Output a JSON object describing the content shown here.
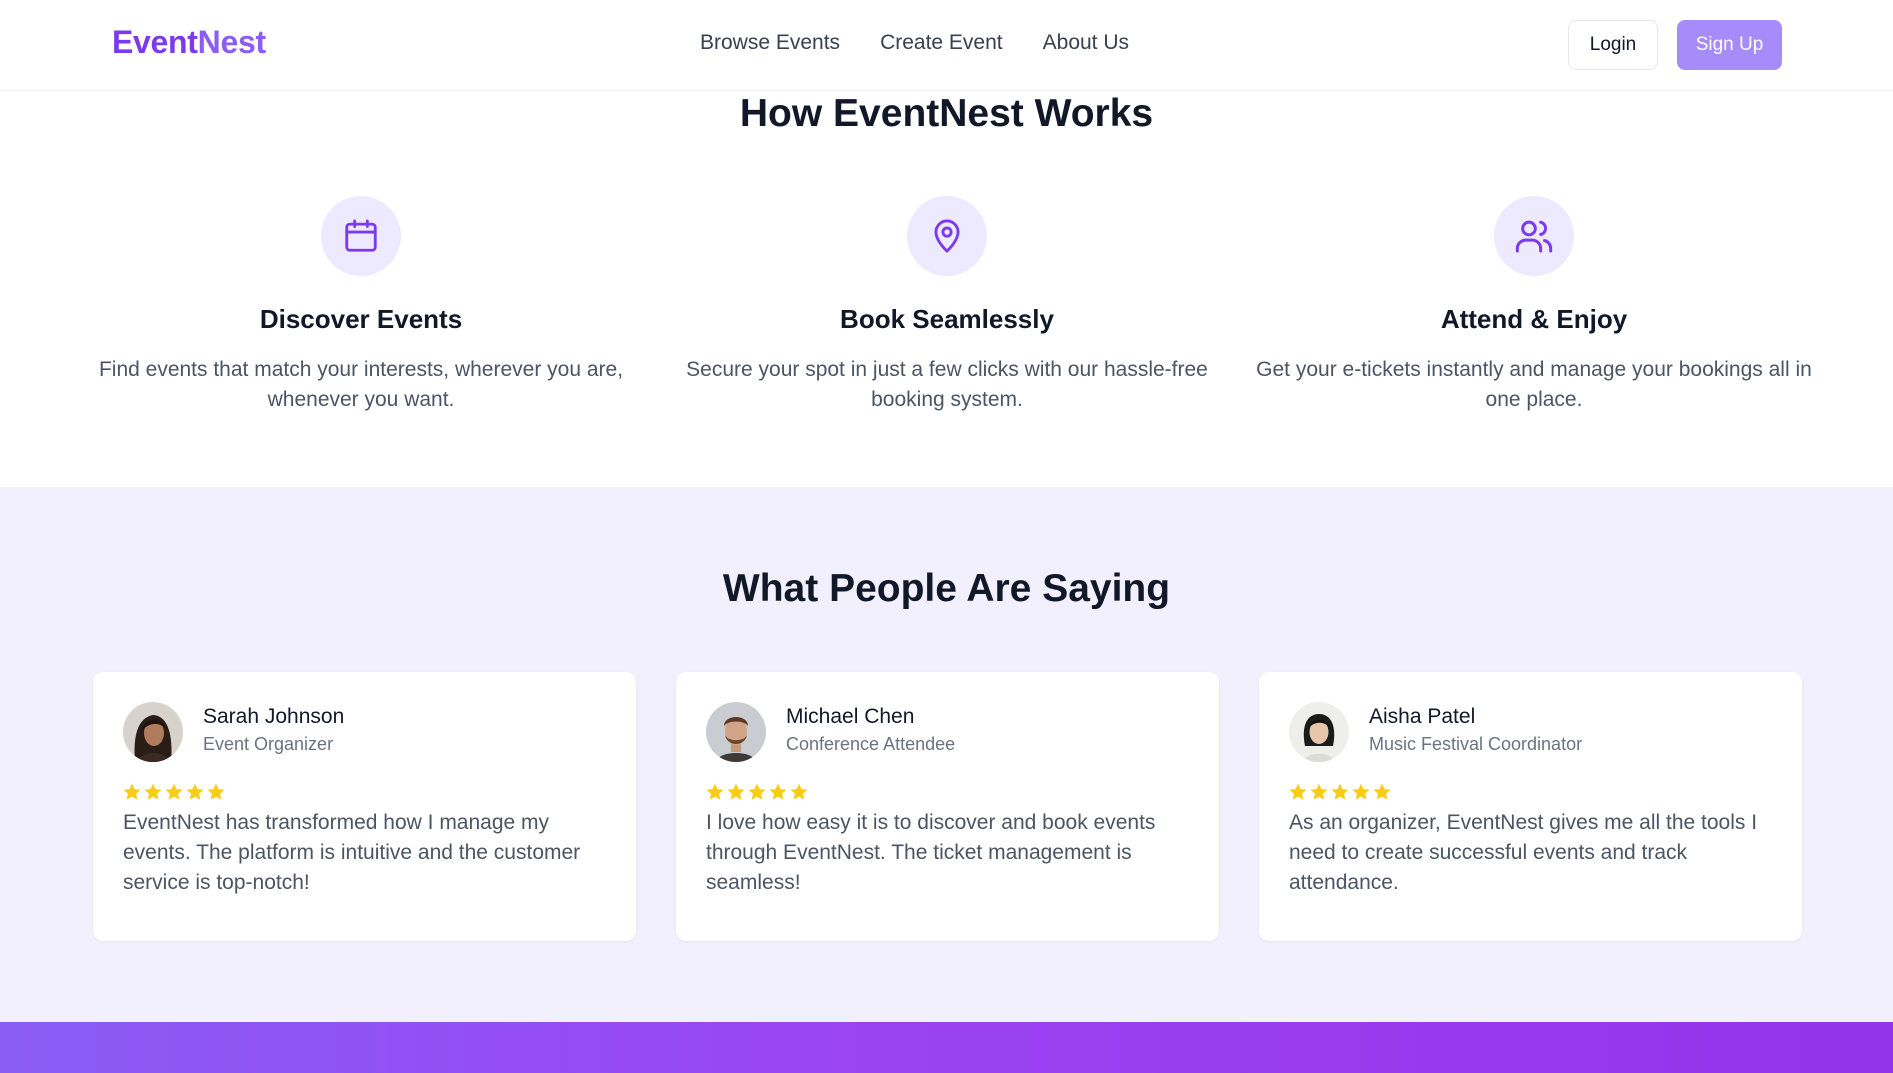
{
  "header": {
    "logo_part1": "Event",
    "logo_part2": "Nest",
    "nav": [
      "Browse Events",
      "Create Event",
      "About Us"
    ],
    "login_label": "Login",
    "signup_label": "Sign Up"
  },
  "works": {
    "title": "How EventNest Works",
    "features": [
      {
        "icon": "calendar-icon",
        "title": "Discover Events",
        "text": "Find events that match your interests, wherever you are, whenever you want."
      },
      {
        "icon": "map-pin-icon",
        "title": "Book Seamlessly",
        "text": "Secure your spot in just a few clicks with our hassle-free booking system."
      },
      {
        "icon": "users-icon",
        "title": "Attend & Enjoy",
        "text": "Get your e-tickets instantly and manage your bookings all in one place."
      }
    ]
  },
  "testimonials": {
    "title": "What People Are Saying",
    "items": [
      {
        "name": "Sarah Johnson",
        "role": "Event Organizer",
        "rating": 5,
        "quote": "EventNest has transformed how I manage my events. The platform is intuitive and the customer service is top-notch!"
      },
      {
        "name": "Michael Chen",
        "role": "Conference Attendee",
        "rating": 5,
        "quote": "I love how easy it is to discover and book events through EventNest. The ticket management is seamless!"
      },
      {
        "name": "Aisha Patel",
        "role": "Music Festival Coordinator",
        "rating": 5,
        "quote": "As an organizer, EventNest gives me all the tools I need to create successful events and track attendance."
      }
    ]
  },
  "colors": {
    "accent": "#7c3aed",
    "accent_light": "#ede9fe",
    "signup_bg": "#a78bfa",
    "testimonials_bg": "#f3f0fe",
    "star": "#facc15"
  }
}
